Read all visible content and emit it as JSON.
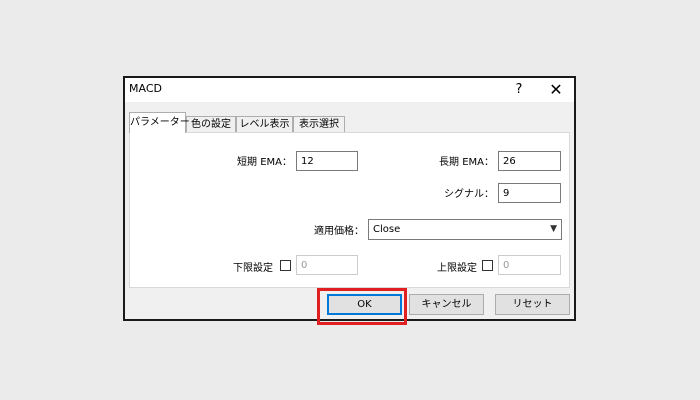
{
  "window": {
    "title": "MACD",
    "help_label": "?",
    "close_label": "✕"
  },
  "tabs": [
    {
      "label": "パラメーター",
      "active": true
    },
    {
      "label": "色の設定",
      "active": false
    },
    {
      "label": "レベル表示",
      "active": false
    },
    {
      "label": "表示選択",
      "active": false
    }
  ],
  "params": {
    "fast_ema_label": "短期 EMA：",
    "fast_ema_value": "12",
    "slow_ema_label": "長期 EMA：",
    "slow_ema_value": "26",
    "signal_label": "シグナル：",
    "signal_value": "9",
    "apply_price_label": "適用価格：",
    "apply_price_value": "Close",
    "lower_limit_label": "下限設定",
    "lower_limit_value": "0",
    "upper_limit_label": "上限設定",
    "upper_limit_value": "0"
  },
  "buttons": {
    "ok_label": "OK",
    "cancel_label": "キャンセル",
    "reset_label": "リセット"
  },
  "colors": {
    "highlight": "#e02020",
    "focus": "#0078d7"
  }
}
